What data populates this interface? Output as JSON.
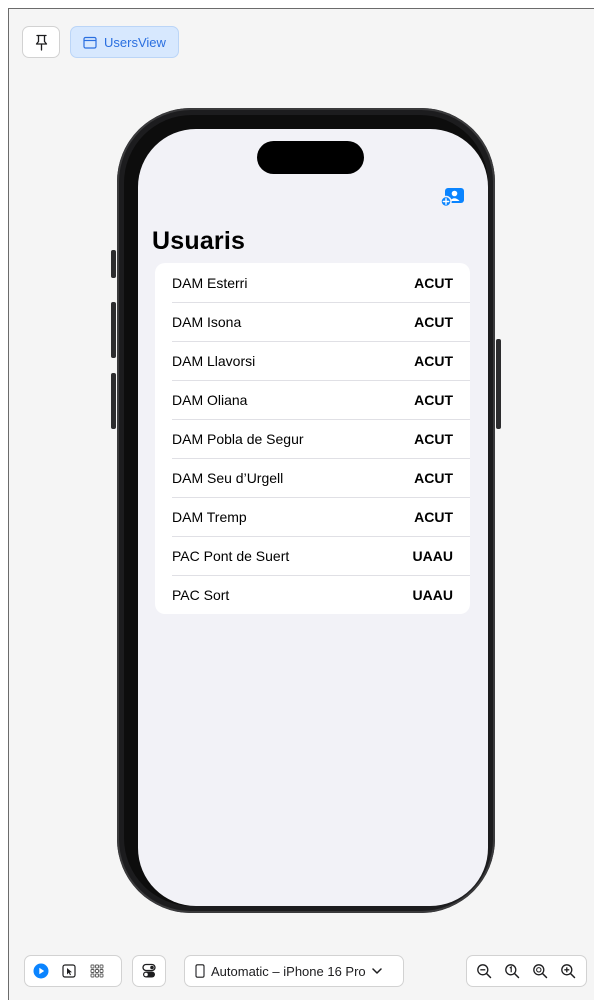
{
  "toolbar": {
    "preview_tab_label": "UsersView"
  },
  "screen": {
    "title": "Usuaris",
    "users": [
      {
        "name": "DAM Esterri",
        "code": "ACUT"
      },
      {
        "name": "DAM Isona",
        "code": "ACUT"
      },
      {
        "name": "DAM Llavorsi",
        "code": "ACUT"
      },
      {
        "name": "DAM Oliana",
        "code": "ACUT"
      },
      {
        "name": "DAM Pobla de Segur",
        "code": "ACUT"
      },
      {
        "name": "DAM Seu d’Urgell",
        "code": "ACUT"
      },
      {
        "name": "DAM Tremp",
        "code": "ACUT"
      },
      {
        "name": "PAC Pont de Suert",
        "code": "UAAU"
      },
      {
        "name": "PAC Sort",
        "code": "UAAU"
      }
    ]
  },
  "bottom_bar": {
    "device_label": "Automatic – iPhone 16 Pro"
  },
  "colors": {
    "accent": "#0a84ff",
    "tab_bg": "#d7e8fe",
    "screen_bg": "#f2f2f7"
  },
  "icons": {
    "pin": "pin-icon",
    "preview": "preview-window-icon",
    "add_user": "add-user-icon",
    "live": "live-play-icon",
    "selectable": "selectable-cursor-icon",
    "grid": "grid-icon",
    "variants": "toggle-variants-icon",
    "device": "iphone-icon",
    "chevron": "chevron-down-icon",
    "zoom_out": "zoom-out-icon",
    "zoom_100": "zoom-100-icon",
    "zoom_fit": "zoom-fit-icon",
    "zoom_in": "zoom-in-icon"
  }
}
